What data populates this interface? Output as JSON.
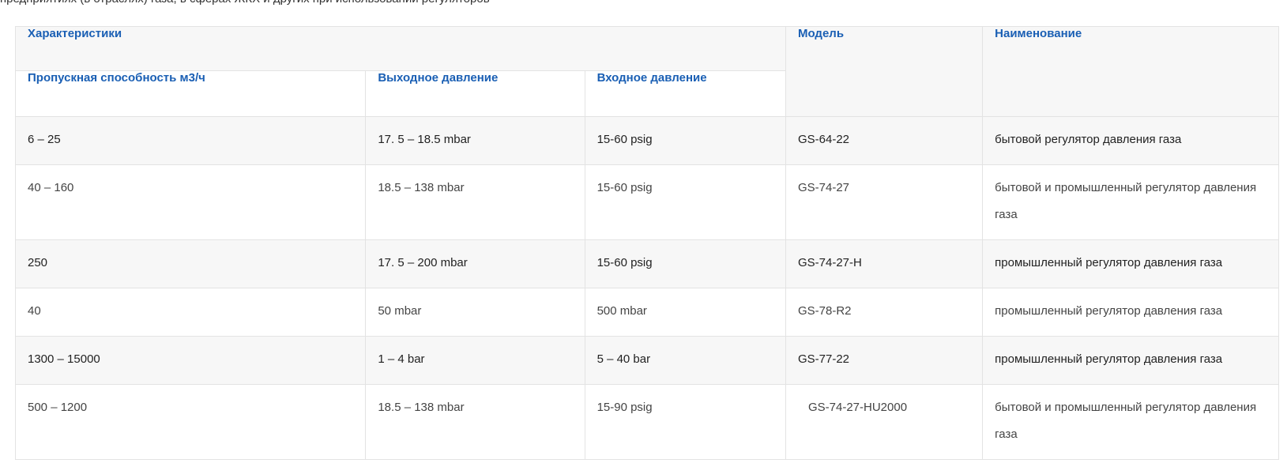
{
  "intro_text": "предприятиях (в отраслях) газа, в сферах ЖКХ и других при использовании регуляторов",
  "table": {
    "headers": {
      "characteristics": "Характеристики",
      "model": "Модель",
      "name": "Наименование",
      "throughput": "Пропускная способность м3/ч",
      "outlet_pressure": "Выходное давление",
      "inlet_pressure": "Входное давление"
    },
    "rows": [
      {
        "throughput": "6 – 25",
        "outlet": "17. 5  – 18.5 mbar",
        "inlet": "15-60 psig",
        "model": "GS-64-22",
        "name": "бытовой регулятор давления газа"
      },
      {
        "throughput": "40 – 160",
        "outlet": "18.5 – 138 mbar",
        "inlet": "15-60 psig",
        "model": "GS-74-27",
        "name": "бытовой и промышленный регулятор давления  газа"
      },
      {
        "throughput": "250",
        "outlet": "17. 5  – 200 mbar",
        "inlet": "15-60 psig",
        "model": "GS-74-27-H",
        "name": "промышленный регулятор давления газа"
      },
      {
        "throughput": "40",
        "outlet": "50 mbar",
        "inlet": "500 mbar",
        "model": "GS-78-R2",
        "name": "промышленный регулятор давления газа"
      },
      {
        "throughput": "1300 – 15000",
        "outlet": "1 – 4 bar",
        "inlet": "5 – 40 bar",
        "model": "GS-77-22",
        "name": "промышленный регулятор давления газа"
      },
      {
        "throughput": "500 – 1200",
        "outlet": "18.5 – 138 mbar",
        "inlet": "15-90 psig",
        "model": "GS-74-27-HU2000",
        "name": "бытовой и промышленный регулятор давления газа"
      }
    ]
  }
}
